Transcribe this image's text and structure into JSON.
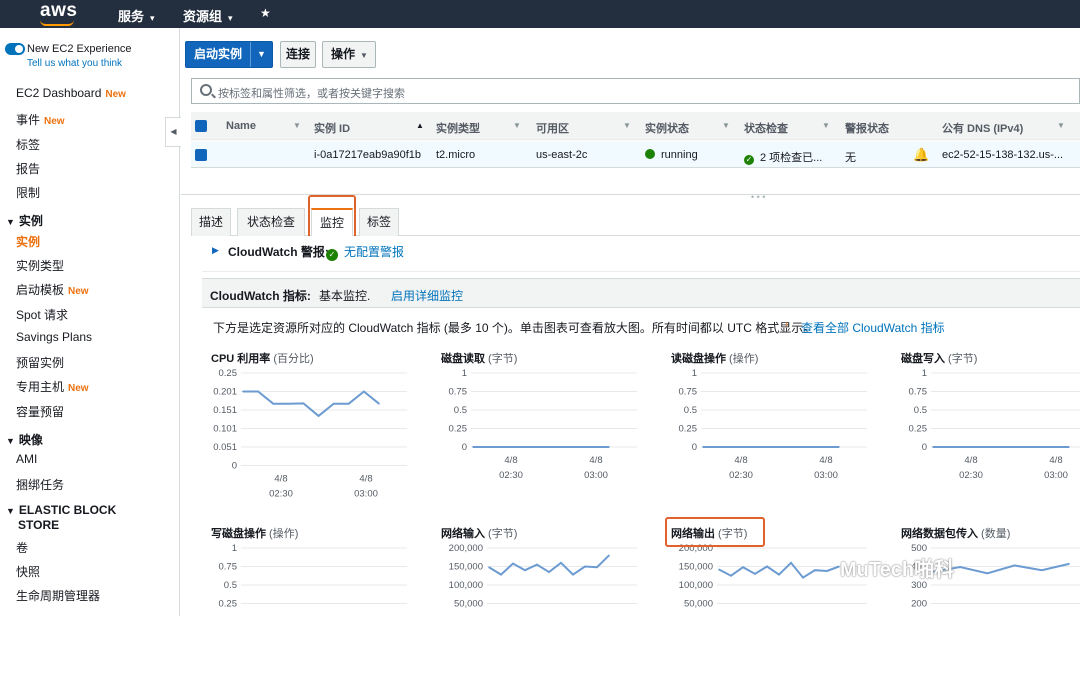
{
  "topnav": {
    "logo": "aws",
    "services": "服务",
    "resource_groups": "资源组",
    "caret": "▾",
    "pin": "★"
  },
  "sidebar": {
    "new_experience": "New EC2 Experience",
    "tell_us": "Tell us what you think",
    "items": [
      {
        "label": "EC2 Dashboard",
        "badge": "New"
      },
      {
        "label": "事件",
        "badge": "New"
      },
      {
        "label": "标签"
      },
      {
        "label": "报告"
      },
      {
        "label": "限制"
      }
    ],
    "section_instances": "实例",
    "instance_items": [
      {
        "label": "实例"
      },
      {
        "label": "实例类型"
      },
      {
        "label": "启动模板",
        "badge": "New"
      },
      {
        "label": "Spot 请求"
      },
      {
        "label": "Savings Plans"
      },
      {
        "label": "预留实例"
      },
      {
        "label": "专用主机",
        "badge": "New"
      },
      {
        "label": "容量预留"
      }
    ],
    "section_images": "映像",
    "image_items": [
      {
        "label": "AMI"
      },
      {
        "label": "捆绑任务"
      }
    ],
    "section_ebs_1": "ELASTIC BLOCK",
    "section_ebs_2": "STORE",
    "ebs_items": [
      {
        "label": "卷"
      },
      {
        "label": "快照"
      },
      {
        "label": "生命周期管理器"
      }
    ]
  },
  "toolbar": {
    "launch": "启动实例",
    "connect": "连接",
    "actions": "操作"
  },
  "filter": {
    "placeholder": "按标签和属性筛选，或者按关键字搜索"
  },
  "table": {
    "columns": [
      "Name",
      "实例 ID",
      "实例类型",
      "可用区",
      "实例状态",
      "状态检查",
      "警报状态",
      "公有 DNS (IPv4)"
    ],
    "row": {
      "name": "",
      "instance_id": "i-0a17217eab9a90f1b",
      "type": "t2.micro",
      "zone": "us-east-2c",
      "state": "running",
      "check": "2 项检查已...",
      "alarm": "无",
      "dns": "ec2-52-15-138-132.us-..."
    }
  },
  "tabs": [
    "描述",
    "状态检查",
    "监控",
    "标签"
  ],
  "cloudwatch": {
    "alarm_label": "CloudWatch 警报:",
    "alarm_value": "无配置警报",
    "metrics_label": "CloudWatch 指标:",
    "metrics_value": "基本监控.",
    "metrics_link": "启用详细监控",
    "description": "下方是选定资源所对应的 CloudWatch 指标 (最多 10 个)。单击图表可查看放大图。所有时间都以 UTC 格式显示。",
    "view_all": "查看全部 CloudWatch 指标"
  },
  "watermark": "MuTech啪科",
  "chart_data": [
    {
      "type": "line",
      "title": "CPU 利用率",
      "unit": "(百分比)",
      "yticks": [
        "0.25",
        "0.201",
        "0.151",
        "0.101",
        "0.051",
        "0"
      ],
      "ylim": [
        0,
        0.25
      ],
      "xticks": [
        {
          "date": "4/8",
          "time": "02:30"
        },
        {
          "date": "4/8",
          "time": "03:00"
        }
      ],
      "x": [
        0,
        1,
        2,
        3,
        4,
        5,
        6,
        7,
        8,
        9
      ],
      "values": [
        0.2,
        0.2,
        0.167,
        0.167,
        0.168,
        0.134,
        0.167,
        0.167,
        0.2,
        0.167
      ]
    },
    {
      "type": "line",
      "title": "磁盘读取",
      "unit": "(字节)",
      "yticks": [
        "1",
        "0.75",
        "0.5",
        "0.25",
        "0"
      ],
      "ylim": [
        0,
        1
      ],
      "xticks": [
        {
          "date": "4/8",
          "time": "02:30"
        },
        {
          "date": "4/8",
          "time": "03:00"
        }
      ],
      "x": [
        0,
        9
      ],
      "values": [
        0,
        0
      ]
    },
    {
      "type": "line",
      "title": "读磁盘操作",
      "unit": "(操作)",
      "yticks": [
        "1",
        "0.75",
        "0.5",
        "0.25",
        "0"
      ],
      "ylim": [
        0,
        1
      ],
      "xticks": [
        {
          "date": "4/8",
          "time": "02:30"
        },
        {
          "date": "4/8",
          "time": "03:00"
        }
      ],
      "x": [
        0,
        9
      ],
      "values": [
        0,
        0
      ]
    },
    {
      "type": "line",
      "title": "磁盘写入",
      "unit": "(字节)",
      "yticks": [
        "1",
        "0.75",
        "0.5",
        "0.25",
        "0"
      ],
      "ylim": [
        0,
        1
      ],
      "xticks": [
        {
          "date": "4/8",
          "time": "02:30"
        },
        {
          "date": "4/8",
          "time": "03:00"
        }
      ],
      "x": [
        0,
        9
      ],
      "values": [
        0,
        0
      ]
    },
    {
      "type": "line",
      "title": "写磁盘操作",
      "unit": "(操作)",
      "yticks": [
        "1",
        "0.75",
        "0.5",
        "0.25"
      ],
      "ylim": [
        0,
        1
      ],
      "xticks": [],
      "x": [],
      "values": []
    },
    {
      "type": "line",
      "title": "网络输入",
      "unit": "(字节)",
      "yticks": [
        "200,000",
        "150,000",
        "100,000",
        "50,000"
      ],
      "ylim": [
        50000,
        200000
      ],
      "xticks": [],
      "x": [
        0,
        1,
        2,
        3,
        4,
        5,
        6,
        7,
        8,
        9,
        10
      ],
      "values": [
        148000,
        128000,
        158000,
        140000,
        155000,
        135000,
        160000,
        128000,
        150000,
        148000,
        180000
      ]
    },
    {
      "type": "line",
      "title": "网络输出",
      "unit": "(字节)",
      "yticks": [
        "200,000",
        "150,000",
        "100,000",
        "50,000"
      ],
      "ylim": [
        50000,
        200000
      ],
      "xticks": [],
      "x": [
        0,
        1,
        2,
        3,
        4,
        5,
        6,
        7,
        8,
        9,
        10
      ],
      "values": [
        142000,
        125000,
        148000,
        130000,
        150000,
        128000,
        160000,
        120000,
        140000,
        138000,
        150000
      ]
    },
    {
      "type": "line",
      "title": "网络数据包传入",
      "unit": "(数量)",
      "yticks": [
        "500",
        "400",
        "300",
        "200"
      ],
      "ylim": [
        150,
        500
      ],
      "xticks": [],
      "x": [
        0,
        1,
        2,
        3,
        4,
        5
      ],
      "values": [
        350,
        380,
        340,
        390,
        360,
        400
      ]
    }
  ]
}
